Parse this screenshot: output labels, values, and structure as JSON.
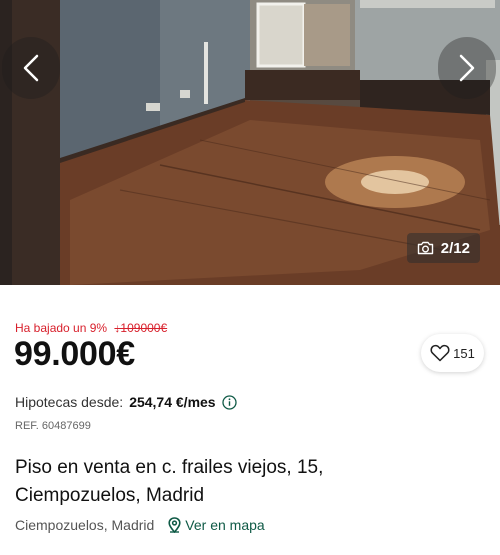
{
  "gallery": {
    "photo_counter": "2/12",
    "prev_icon": "chevron-left-icon",
    "next_icon": "chevron-right-icon",
    "camera_icon": "camera-icon"
  },
  "listing": {
    "price_drop_text": "Ha bajado un 9%",
    "old_price": "↓109000€",
    "price": "99.000€",
    "favorites_count": "151",
    "mortgage_label": "Hipotecas desde:",
    "mortgage_value": "254,74 €/mes",
    "reference": "REF. 60487699",
    "title_line1": "Piso en venta en c. frailes viejos, 15,",
    "title_line2": "Ciempozuelos, Madrid",
    "location": "Ciempozuelos, Madrid",
    "map_link": "Ver en mapa"
  },
  "colors": {
    "price_drop": "#d8202c",
    "map_link": "#0f5a46",
    "text": "#111111"
  }
}
